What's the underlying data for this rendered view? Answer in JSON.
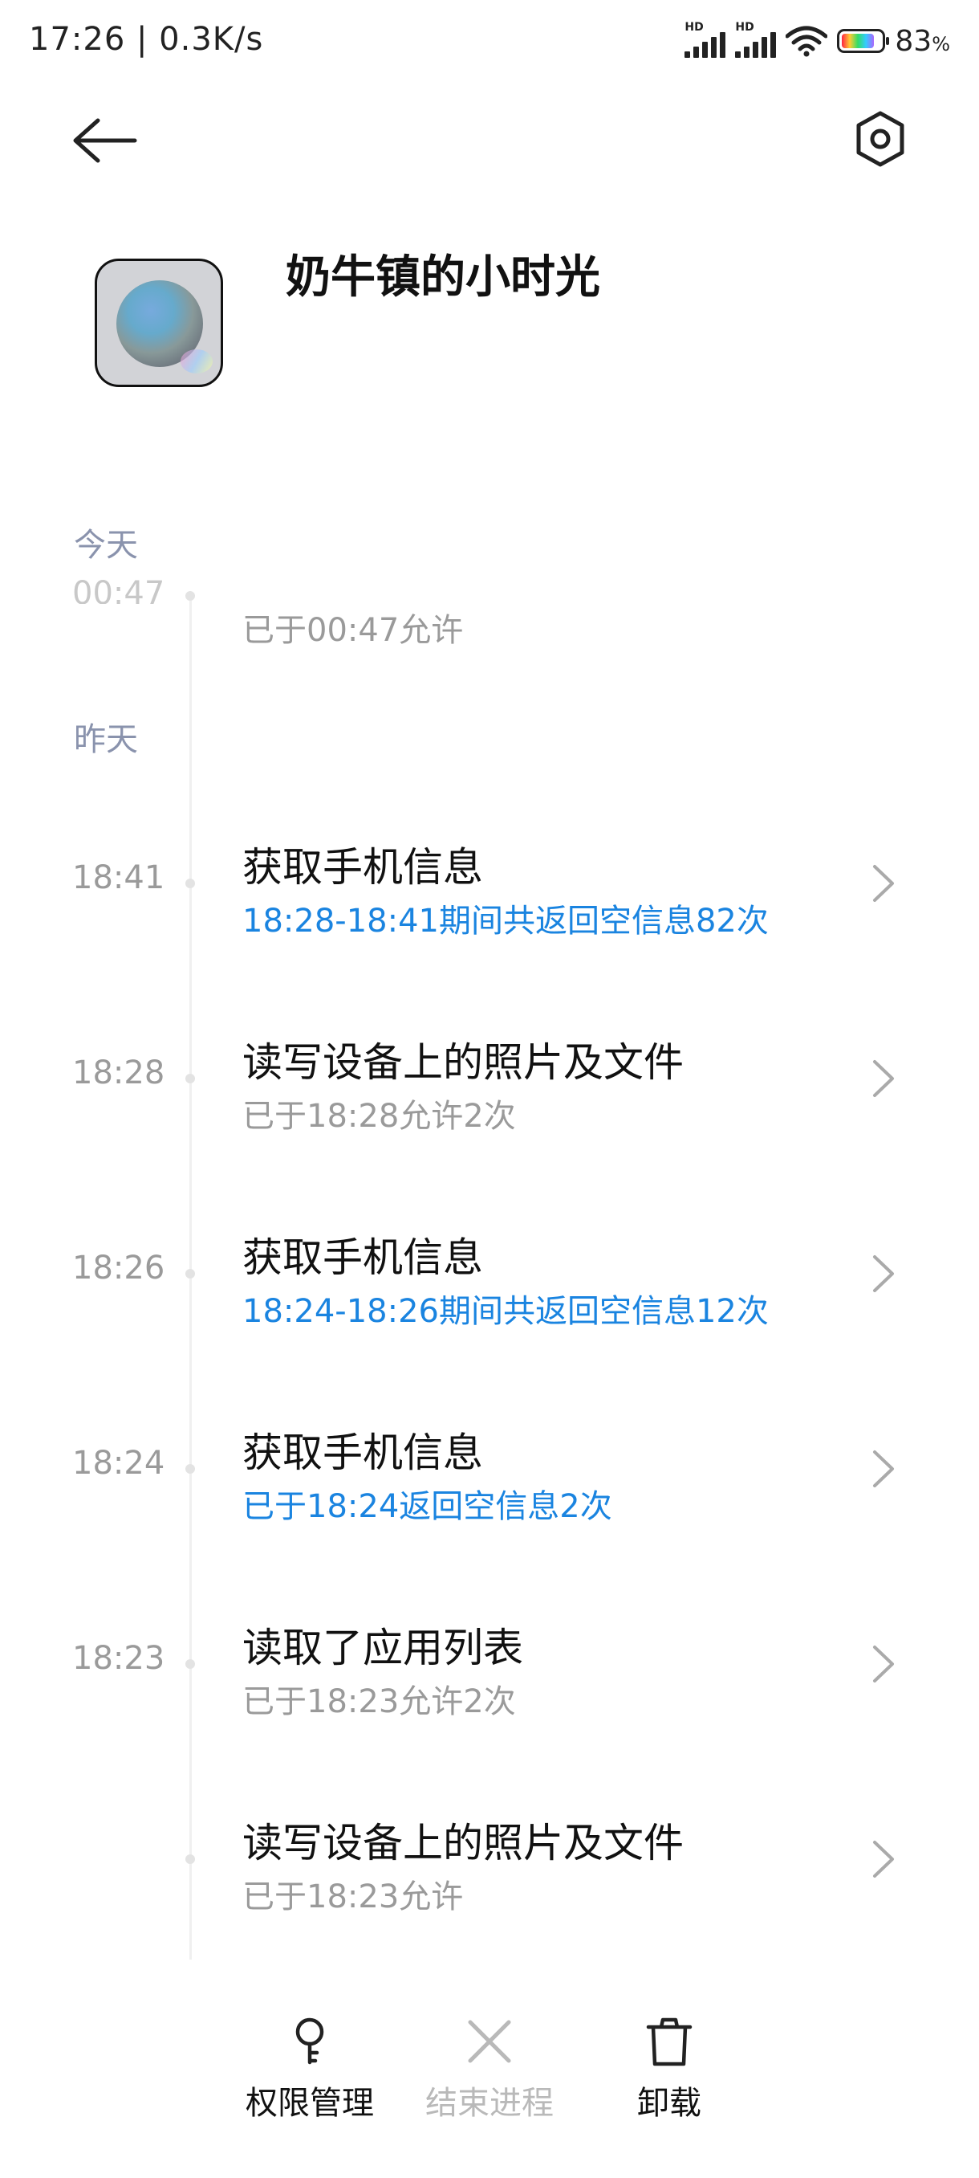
{
  "status_bar": {
    "time_speed": "17:26 | 0.3K/s",
    "network_label": "HD",
    "battery_level": 0.83,
    "battery_percent": "83",
    "battery_unit": "%"
  },
  "header": {
    "app_name": "奶牛镇的小时光"
  },
  "timeline": {
    "today_label": "今天",
    "today_entry": {
      "time": "00:47",
      "subtitle": "已于00:47允许"
    },
    "yesterday_label": "昨天",
    "entries": [
      {
        "time": "18:41",
        "title": "获取手机信息",
        "subtitle": "18:28-18:41期间共返回空信息82次",
        "highlight": true
      },
      {
        "time": "18:28",
        "title": "读写设备上的照片及文件",
        "subtitle": "已于18:28允许2次",
        "highlight": false
      },
      {
        "time": "18:26",
        "title": "获取手机信息",
        "subtitle": "18:24-18:26期间共返回空信息12次",
        "highlight": true
      },
      {
        "time": "18:24",
        "title": "获取手机信息",
        "subtitle": "已于18:24返回空信息2次",
        "highlight": true
      },
      {
        "time": "18:23",
        "title": "读取了应用列表",
        "subtitle": "已于18:23允许2次",
        "highlight": false
      },
      {
        "time": "",
        "title": "读写设备上的照片及文件",
        "subtitle": "已于18:23允许",
        "highlight": false
      }
    ],
    "accent_color": "#1a84e0"
  },
  "bottom_bar": {
    "permissions_label": "权限管理",
    "end_process_label": "结束进程",
    "uninstall_label": "卸载"
  }
}
